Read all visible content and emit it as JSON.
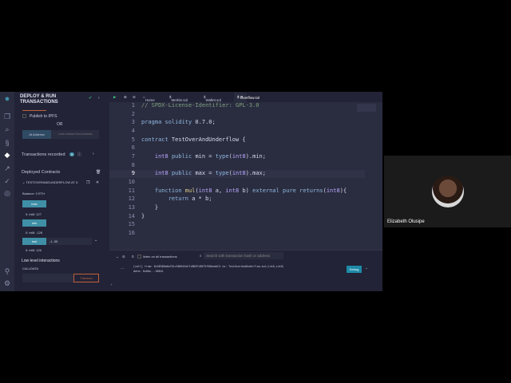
{
  "side_panel": {
    "title_line1": "DEPLOY & RUN",
    "title_line2": "TRANSACTIONS",
    "publish_label": "Publish to IPFS",
    "or_label": "OR",
    "at_address_button": "At Address",
    "load_contract_input": "Load contract from Address",
    "transactions_recorded_label": "Transactions recorded",
    "transactions_recorded_count": "5",
    "deployed_contracts_label": "Deployed Contracts",
    "contract_instance": "TESTOVERANDUNDERFLOW AT 0:",
    "balance": "Balance: 0 ETH",
    "functions": [
      {
        "name": "max",
        "result": "0: int8: 127"
      },
      {
        "name": "min",
        "result": "0: int8: -128"
      },
      {
        "name": "mul",
        "input": "-1, 85",
        "result": "0: int8: 126"
      }
    ],
    "low_level_label": "Low level interactions",
    "calldata_label": "CALLDATA",
    "transact_button": "Transact"
  },
  "editor": {
    "tabs": [
      "Home",
      "Merkle.sol",
      "Wallet.sol",
      "Overflow.sol"
    ],
    "active_tab": "Overflow.sol",
    "line_numbers": [
      "1",
      "2",
      "3",
      "4",
      "5",
      "6",
      "7",
      "8",
      "9",
      "10",
      "11",
      "12",
      "13",
      "14",
      "15",
      "16"
    ]
  },
  "terminal": {
    "count": "0",
    "listen_label": "listen on all transactions",
    "search_placeholder": "Search with transaction hash or address",
    "log_line1": "[call]  from: 0x5B38Da6a701c568545dCfcB03FcB875f56beddC4 to: TestOverAndUnderflow.mul(int8,int8)",
    "log_line2": "data: 0x6be...00041",
    "debug_button": "Debug"
  },
  "video": {
    "participant_name": "Elizabeth Olusipe"
  }
}
